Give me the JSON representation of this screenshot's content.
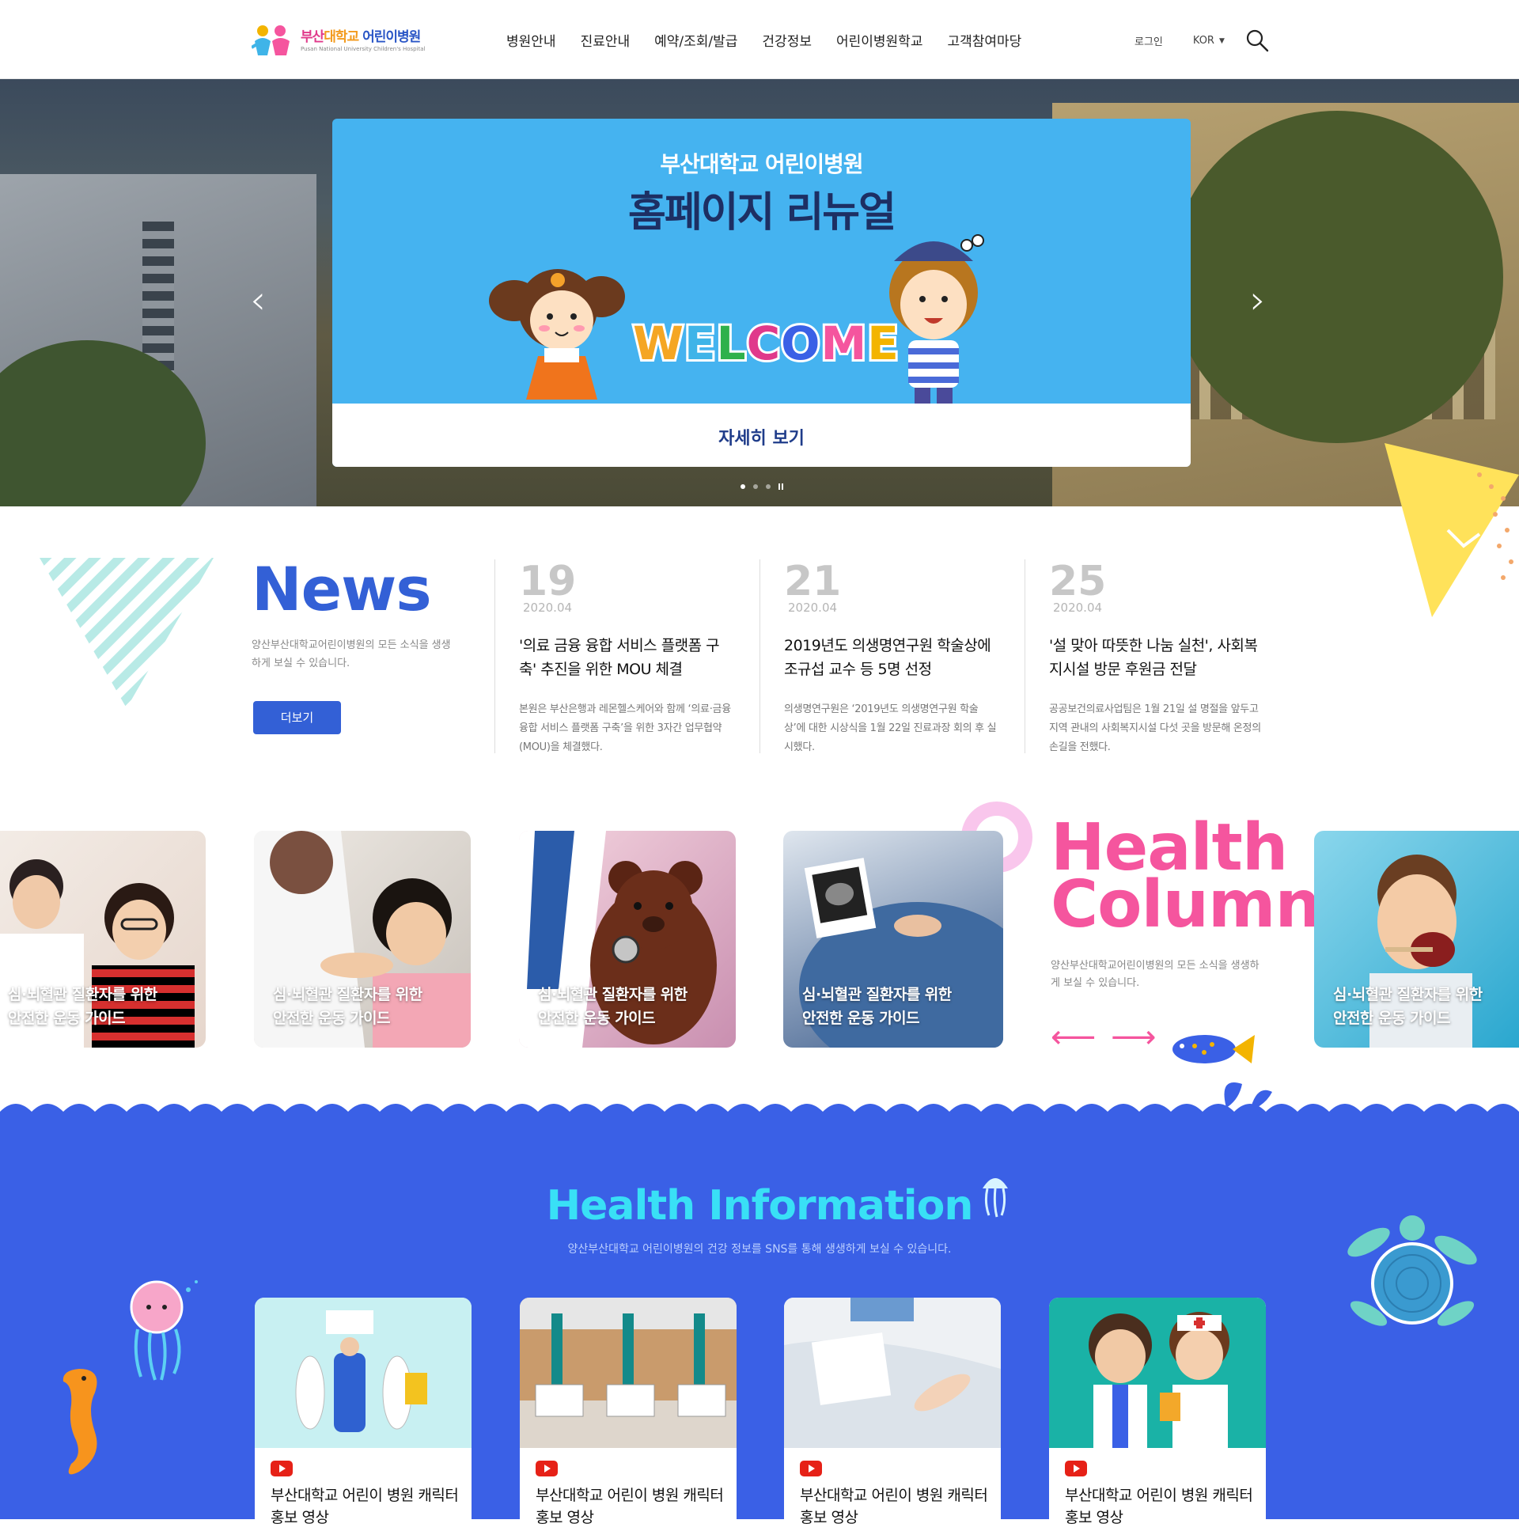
{
  "header": {
    "logo_name": "부산대학교 어린이병원",
    "logo_sub": "Pusan National University Children's Hospital",
    "nav": [
      "병원안내",
      "진료안내",
      "예약/조회/발급",
      "건강정보",
      "어린이병원학교",
      "고객참여마당"
    ],
    "login": "로그인",
    "language": "KOR"
  },
  "hero": {
    "banner_subtitle": "부산대학교 어린이병원",
    "banner_title": "홈페이지 리뉴얼",
    "welcome_text": "WELCOME",
    "more_label": "자세히 보기",
    "slide_index": 1,
    "slide_count": 3
  },
  "news": {
    "title": "News",
    "description": "양산부산대학교어린이병원의 모든 소식을 생생하게 보실 수 있습니다.",
    "more_label": "더보기",
    "items": [
      {
        "day": "19",
        "date": "2020.04",
        "title": "'의료 금융 융합 서비스 플랫폼 구축' 추진을 위한 MOU 체결",
        "body": "본원은 부산은행과 레몬헬스케어와 함께 ‘의료·금융 융합 서비스 플랫폼 구축’을 위한 3자간 업무협약(MOU)을 체결했다."
      },
      {
        "day": "21",
        "date": "2020.04",
        "title": "2019년도 의생명연구원 학술상에 조규섭 교수 등 5명 선정",
        "body": "의생명연구원은 ‘2019년도 의생명연구원 학술상’에 대한 시상식을 1월 22일 진료과장 회의 후 실시했다."
      },
      {
        "day": "25",
        "date": "2020.04",
        "title": "'설 맞아 따뜻한 나눔 실천', 사회복지시설 방문 후원금 전달",
        "body": "공공보건의료사업팀은 1월 21일 설 명절을 앞두고 지역 관내의 사회복지시설 다섯 곳을 방문해 온정의 손길을 전했다."
      }
    ]
  },
  "health_column": {
    "title_line1": "Health",
    "title_line2": "Column",
    "description": "양산부산대학교어린이병원의 모든 소식을 생생하게 보실 수 있습니다.",
    "cards": [
      {
        "line1": "심·뇌혈관 질환자를 위한",
        "line2": "안전한 운동 가이드"
      },
      {
        "line1": "심·뇌혈관 질환자를 위한",
        "line2": "안전한 운동 가이드"
      },
      {
        "line1": "심·뇌혈관 질환자를 위한",
        "line2": "안전한 운동 가이드"
      },
      {
        "line1": "심·뇌혈관 질환자를 위한",
        "line2": "안전한 운동 가이드"
      },
      {
        "line1": "심·뇌혈관 질환자를 위한",
        "line2": "안전한 운동 가이드"
      }
    ]
  },
  "health_info": {
    "title": "Health Information",
    "description": "양산부산대학교 어린이병원의  건강 정보를 SNS를 통해 생생하게 보실 수 있습니다.",
    "cards": [
      {
        "title": "부산대학교 어린이 병원 캐릭터 홍보 영상"
      },
      {
        "title": "부산대학교 어린이 병원 캐릭터 홍보 영상"
      },
      {
        "title": "부산대학교 어린이 병원 캐릭터 홍보 영상"
      },
      {
        "title": "부산대학교 어린이 병원 캐릭터 홍보 영상"
      }
    ]
  },
  "colors": {
    "primary_blue": "#3360d6",
    "pink": "#f5559e",
    "cyan": "#39e0f6",
    "banner_blue": "#45b3f0",
    "ocean": "#3a60e6"
  },
  "icons": [
    "search-icon",
    "caret-down-icon",
    "chevron-left-icon",
    "chevron-right-icon",
    "arrow-left-icon",
    "arrow-right-icon",
    "youtube-icon",
    "pause-icon"
  ]
}
